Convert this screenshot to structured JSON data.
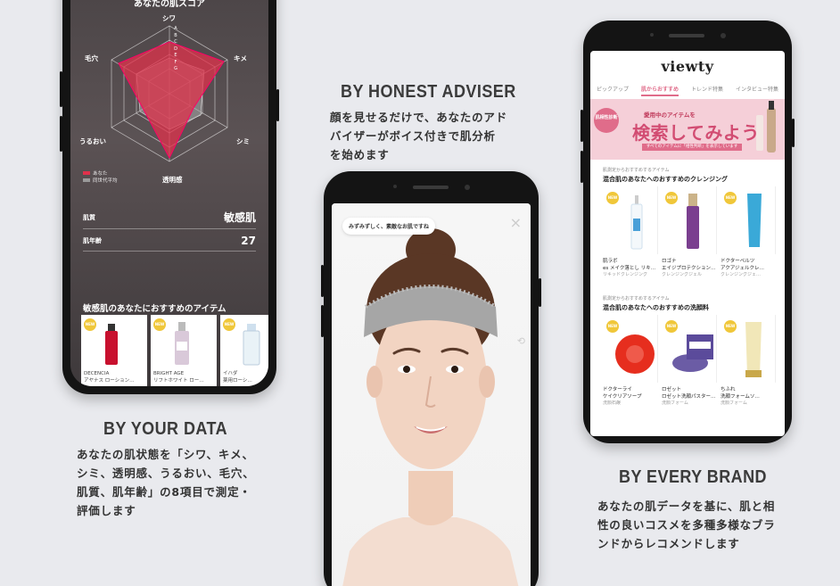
{
  "left_panel": {
    "heading": "BY YOUR DATA",
    "desc_lines": [
      "あなたの肌状態を「シワ、キメ、",
      "シミ、透明感、うるおい、毛穴、",
      "肌質、肌年齢」の8項目で測定・",
      "評価します"
    ],
    "screen": {
      "title": "あなたの肌スコア",
      "radar_labels": {
        "top": "シワ",
        "top_right": "キメ",
        "bottom_right": "シミ",
        "bottom": "透明感",
        "bottom_left": "うるおい",
        "top_left": "毛穴"
      },
      "grades": [
        "A",
        "B",
        "C",
        "D",
        "E",
        "F",
        "G"
      ],
      "legend": [
        {
          "label": "あなた",
          "color": "#e0314b"
        },
        {
          "label": "同世代平均",
          "color": "#9a9a9a"
        }
      ],
      "stats": [
        {
          "key": "肌質",
          "value": "敏感肌"
        },
        {
          "key": "肌年齢",
          "value": "27"
        }
      ],
      "rec_title": "敏感肌のあなたにおすすめのアイテム",
      "products": [
        {
          "badge": "NEW",
          "name1": "DECENCIA",
          "name2": "アヤナス ローション…"
        },
        {
          "badge": "NEW",
          "name1": "BRIGHT AGE",
          "name2": "リフトホワイト ロー…"
        },
        {
          "badge": "NEW",
          "name1": "イハダ",
          "name2": "薬用ローシ…"
        }
      ]
    }
  },
  "center_panel": {
    "heading": "BY HONEST ADVISER",
    "desc_lines": [
      "顔を見せるだけで、あなたのアド",
      "バイザーがボイス付きで肌分析",
      "を始めます"
    ],
    "screen": {
      "bubble": "みずみずしく、素敵なお肌ですね",
      "close_icon": "×",
      "camera_switch_icon": "⟲"
    }
  },
  "right_panel": {
    "heading": "BY EVERY BRAND",
    "desc_lines": [
      "あなたの肌データを基に、肌と相",
      "性の良いコスメを多種多様なブラ",
      "ンドからレコメンドします"
    ],
    "screen": {
      "logo": "viewty",
      "tabs": [
        {
          "label": "ピックアップ",
          "active": false
        },
        {
          "label": "肌からおすすめ",
          "active": true
        },
        {
          "label": "トレンド特集",
          "active": false
        },
        {
          "label": "インタビュー特集",
          "active": false
        }
      ],
      "banner": {
        "round": "肌相性診断",
        "small": "愛用中のアイテムを",
        "big": "検索してみよう",
        "strip": "すべてのアイテムに「相性判断」を表示しています"
      },
      "sections": [
        {
          "sub": "肌測定からおすすめするアイテム",
          "title": "混合肌のあなたへのおすすめのクレンジング",
          "products": [
            {
              "badge": "NEW",
              "name1": "肌ラボ",
              "name2": "es メイク落とし リキ…",
              "cat": "リキッドクレンジング"
            },
            {
              "badge": "NEW",
              "name1": "ロゴナ",
              "name2": "エイジプロテクション…",
              "cat": "クレンジングジェル"
            },
            {
              "badge": "NEW",
              "name1": "ドクターベルツ",
              "name2": "アクアジェルクレ…",
              "cat": "クレンジングジェ…"
            }
          ]
        },
        {
          "sub": "肌測定からおすすめするアイテム",
          "title": "混合肌のあなたへのおすすめの洗顔料",
          "products": [
            {
              "badge": "NEW",
              "name1": "ドクターライ",
              "name2": "ケイクリアソープ",
              "cat": "洗顔石鹸"
            },
            {
              "badge": "NEW",
              "name1": "ロゼット",
              "name2": "ロゼット洗顔パスター…",
              "cat": "洗顔フォーム"
            },
            {
              "badge": "NEW",
              "name1": "ちふれ",
              "name2": "洗顔フォームソ…",
              "cat": "洗顔フォーム"
            }
          ]
        }
      ]
    }
  }
}
